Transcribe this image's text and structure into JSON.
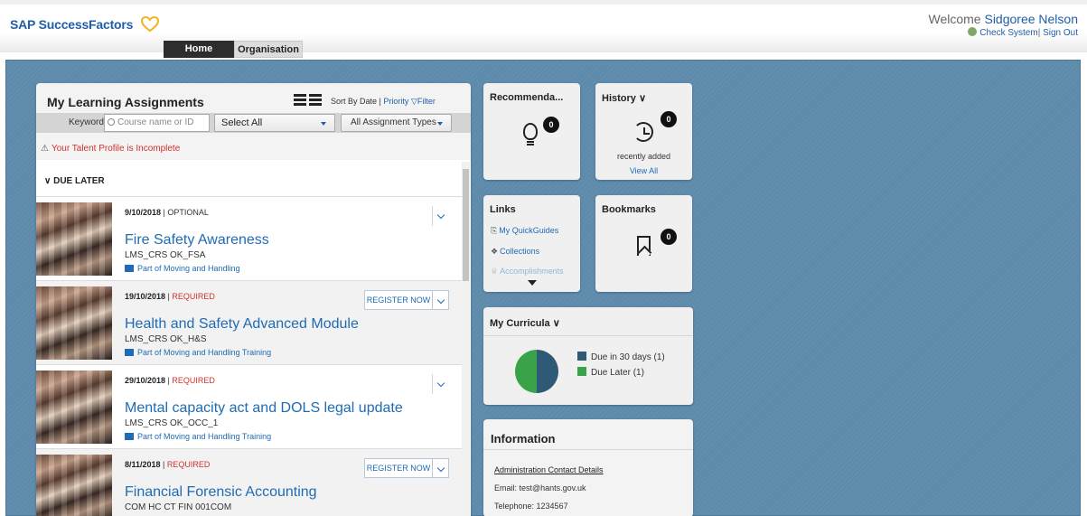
{
  "header": {
    "logo_text": "SAP SuccessFactors",
    "welcome_prefix": "Welcome",
    "user_name": "Sidgoree Nelson",
    "check_system": "Check System",
    "separator": "|",
    "sign_out": "Sign Out",
    "tabs": [
      {
        "label": "Home",
        "active": true
      },
      {
        "label": "Organisation",
        "active": false
      }
    ]
  },
  "learning": {
    "title": "My Learning Assignments",
    "sort_prefix": "Sort By Date |",
    "sort_priority": "Priority",
    "filter": "Filter",
    "keyword_label": "Keyword",
    "keyword_placeholder": "Course name or ID",
    "select_all": "Select All",
    "assignment_types": "All Assignment Types",
    "talent_warning": "Your Talent Profile is Incomplete",
    "group_label": "DUE LATER",
    "items": [
      {
        "date": "9/10/2018",
        "status": "OPTIONAL",
        "title": "Fire Safety Awareness",
        "code": "LMS_CRS OK_FSA",
        "part_of": "Part of Moving and Handling",
        "action": ""
      },
      {
        "date": "19/10/2018",
        "status": "REQUIRED",
        "title": "Health and Safety Advanced Module",
        "code": "LMS_CRS OK_H&S",
        "part_of": "Part of Moving and Handling Training",
        "action": "REGISTER NOW"
      },
      {
        "date": "29/10/2018",
        "status": "REQUIRED",
        "title": "Mental capacity act and DOLS legal update",
        "code": "LMS_CRS OK_OCC_1",
        "part_of": "Part of Moving and Handling Training",
        "action": ""
      },
      {
        "date": "8/11/2018",
        "status": "REQUIRED",
        "title": "Financial Forensic Accounting",
        "code": "COM HC CT FIN 001COM",
        "part_of": "",
        "action": "REGISTER NOW"
      }
    ]
  },
  "recommendations": {
    "title": "Recommenda...",
    "count": "0"
  },
  "history": {
    "title": "History",
    "count": "0",
    "recent": "recently added",
    "view_all": "View All"
  },
  "links": {
    "title": "Links",
    "items": [
      "My QuickGuides",
      "Collections",
      "Accomplishments"
    ]
  },
  "bookmarks": {
    "title": "Bookmarks",
    "count": "0"
  },
  "curricula": {
    "title": "My Curricula",
    "legend": [
      {
        "label": "Due in 30 days (1)",
        "color": "#2e5a76"
      },
      {
        "label": "Due Later (1)",
        "color": "#3aa34a"
      }
    ]
  },
  "information": {
    "title": "Information",
    "contact_link": "Administration Contact Details",
    "email": "Email: test@hants.gov.uk",
    "telephone": "Telephone: 1234567"
  },
  "colors": {
    "brand": "#1f5ea8",
    "canvas": "#5e8aab",
    "required": "#d0332d"
  }
}
